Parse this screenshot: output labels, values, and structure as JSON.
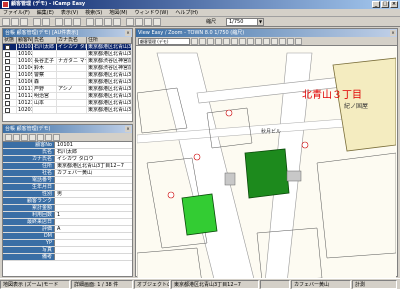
{
  "window": {
    "title": "顧客管理 (デモ) - iCamp Easy"
  },
  "menu": [
    "ファイル(F)",
    "編集(E)",
    "表示(V)",
    "検索(S)",
    "地図(M)",
    "ウィンドウ(W)",
    "ヘルプ(H)"
  ],
  "toolbar": {
    "scale_label": "縮尺",
    "scale_value": "1/750"
  },
  "list_panel": {
    "title": "台帳  顧客管理(デモ)  [AU件表示]",
    "columns": [
      "状態",
      "顧客No",
      "氏名",
      "カナ氏名",
      "住所"
    ],
    "rows": [
      {
        "code": "10101",
        "name": "石川太郎",
        "kana": "イシカワ タロウ",
        "address": "東京都港区北青山3丁目",
        "selected": true
      },
      {
        "code": "10102",
        "name": "",
        "kana": "",
        "address": "東京都港区北青山3丁目",
        "selected": false
      },
      {
        "code": "10103",
        "name": "長谷正子",
        "kana": "ナガタニ マサコ",
        "address": "東京都渋谷区神宮前5丁",
        "selected": false
      },
      {
        "code": "10104",
        "name": "鈴木",
        "kana": "",
        "address": "東京都渋谷区神宮前5丁",
        "selected": false
      },
      {
        "code": "10105",
        "name": "警察",
        "kana": "",
        "address": "東京都港区北青山3丁",
        "selected": false
      },
      {
        "code": "10106",
        "name": "森",
        "kana": "",
        "address": "東京都港区北青山3丁",
        "selected": false
      },
      {
        "code": "10111",
        "name": "芦野",
        "kana": "アシノ",
        "address": "東京都港区北青山3丁",
        "selected": false
      },
      {
        "code": "10112",
        "name": "明治宮",
        "kana": "",
        "address": "東京都港区北青山3丁",
        "selected": false
      },
      {
        "code": "10121",
        "name": "山本",
        "kana": "",
        "address": "東京都港区北青山3丁",
        "selected": false
      },
      {
        "code": "10201",
        "name": "",
        "kana": "",
        "address": "東京都港区北青山3丁",
        "selected": false
      }
    ]
  },
  "detail_panel": {
    "title": "台帳  顧客管理(デモ)",
    "fields": [
      {
        "label": "顧客No",
        "value": "10101"
      },
      {
        "label": "氏名",
        "value": "石川太郎"
      },
      {
        "label": "カナ氏名",
        "value": "イシカワ タロウ"
      },
      {
        "label": "住所",
        "value": "東京都港区北青山3丁目12−7"
      },
      {
        "label": "社名",
        "value": "カフェバー黄山"
      },
      {
        "label": "電話番号",
        "value": ""
      },
      {
        "label": "生年月日",
        "value": ""
      },
      {
        "label": "性別",
        "value": "男"
      },
      {
        "label": "顧客ランク",
        "value": ""
      },
      {
        "label": "累計金額",
        "value": ""
      },
      {
        "label": "利用回数",
        "value": "1"
      },
      {
        "label": "最終来店日",
        "value": ""
      },
      {
        "label": "評価",
        "value": "A"
      },
      {
        "label": "DM",
        "value": ""
      },
      {
        "label": "YP",
        "value": ""
      },
      {
        "label": "写真",
        "value": ""
      },
      {
        "label": "備考",
        "value": ""
      }
    ]
  },
  "map_panel": {
    "title": "View  Easy / Zoom - TOWN 8.0 1/750 (縮尺)",
    "layer_select": "顧客管理 (デモ)",
    "area_label": "北青山３丁目",
    "facility_label": "紀ノ国屋",
    "building_label": "秋月ビル"
  },
  "status": {
    "mode": "地図表示 (ズーム)モード",
    "record": "詳細画面: 1 / 38 件",
    "object": "オブジェクトの選択",
    "address": "東京都港区北青山3丁目12−7",
    "empty": "",
    "name": "カフェバー黄山",
    "extra": "計測"
  }
}
